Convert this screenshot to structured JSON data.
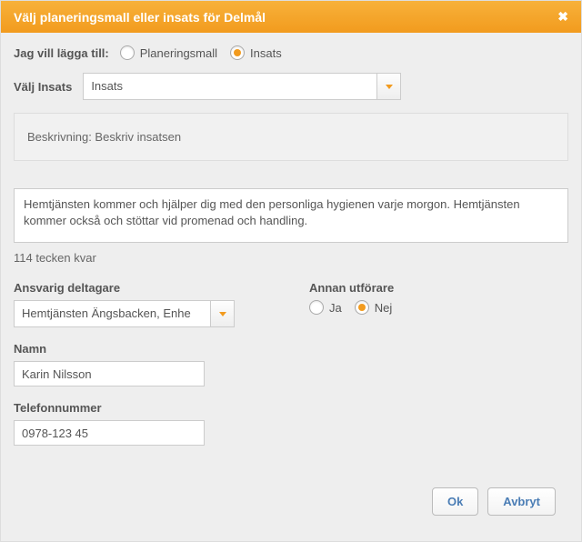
{
  "header": {
    "title": "Välj planeringsmall eller insats för Delmål"
  },
  "add_row": {
    "label": "Jag vill lägga till:",
    "option_template": "Planeringsmall",
    "option_insats": "Insats"
  },
  "select_insats": {
    "label": "Välj Insats",
    "value": "Insats"
  },
  "description_box": "Beskrivning: Beskriv insatsen",
  "textarea_value": "Hemtjänsten kommer och hjälper dig med den personliga hygienen varje morgon. Hemtjänsten kommer också och stöttar vid promenad och handling.",
  "char_count": "114 tecken kvar",
  "responsible": {
    "label": "Ansvarig deltagare",
    "value": "Hemtjänsten Ängsbacken, Enhe"
  },
  "other_performer": {
    "label": "Annan utförare",
    "yes": "Ja",
    "no": "Nej"
  },
  "name": {
    "label": "Namn",
    "value": "Karin Nilsson"
  },
  "phone": {
    "label": "Telefonnummer",
    "value": "0978-123 45"
  },
  "buttons": {
    "ok": "Ok",
    "cancel": "Avbryt"
  }
}
